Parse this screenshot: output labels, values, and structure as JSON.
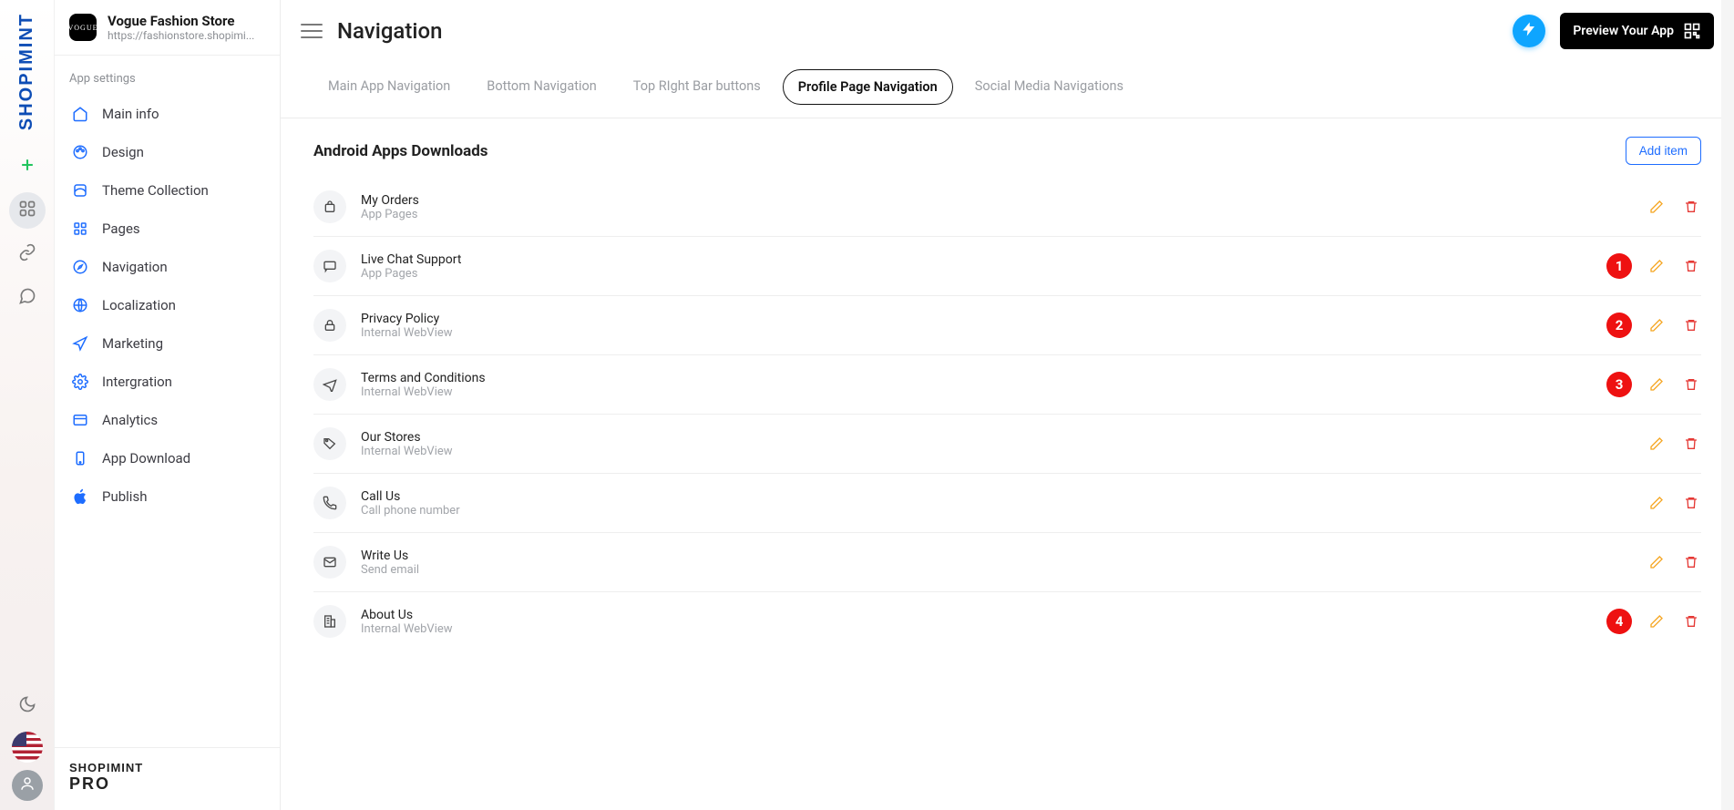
{
  "rail": {
    "logo_text": "SHOPIMINT"
  },
  "store": {
    "name": "Vogue Fashion Store",
    "url": "https://fashionstore.shopimi...",
    "logo_text": "VOGUE"
  },
  "sidebar": {
    "section_label": "App settings",
    "items": [
      {
        "label": "Main info"
      },
      {
        "label": "Design"
      },
      {
        "label": "Theme Collection"
      },
      {
        "label": "Pages"
      },
      {
        "label": "Navigation"
      },
      {
        "label": "Localization"
      },
      {
        "label": "Marketing"
      },
      {
        "label": "Intergration"
      },
      {
        "label": "Analytics"
      },
      {
        "label": "App Download"
      },
      {
        "label": "Publish"
      }
    ],
    "footer": {
      "brand": "SHOPIMINT",
      "tier": "PRO"
    }
  },
  "header": {
    "title": "Navigation",
    "preview_label": "Preview Your App"
  },
  "tabs": [
    {
      "label": "Main App Navigation"
    },
    {
      "label": "Bottom Navigation"
    },
    {
      "label": "Top RIght Bar buttons"
    },
    {
      "label": "Profile Page Navigation"
    },
    {
      "label": "Social Media Navigations"
    }
  ],
  "content": {
    "subtitle": "Android Apps Downloads",
    "add_label": "Add item",
    "items": [
      {
        "title": "My Orders",
        "subtitle": "App Pages",
        "badge": null,
        "icon": "bag"
      },
      {
        "title": "Live Chat Support",
        "subtitle": "App Pages",
        "badge": "1",
        "icon": "chat"
      },
      {
        "title": "Privacy Policy",
        "subtitle": "Internal WebView",
        "badge": "2",
        "icon": "lock"
      },
      {
        "title": "Terms and Conditions",
        "subtitle": "Internal WebView",
        "badge": "3",
        "icon": "plane"
      },
      {
        "title": "Our Stores",
        "subtitle": "Internal WebView",
        "badge": null,
        "icon": "tag"
      },
      {
        "title": "Call Us",
        "subtitle": "Call phone number",
        "badge": null,
        "icon": "phone"
      },
      {
        "title": "Write Us",
        "subtitle": "Send email",
        "badge": null,
        "icon": "mail"
      },
      {
        "title": "About Us",
        "subtitle": "Internal WebView",
        "badge": "4",
        "icon": "building"
      }
    ]
  }
}
